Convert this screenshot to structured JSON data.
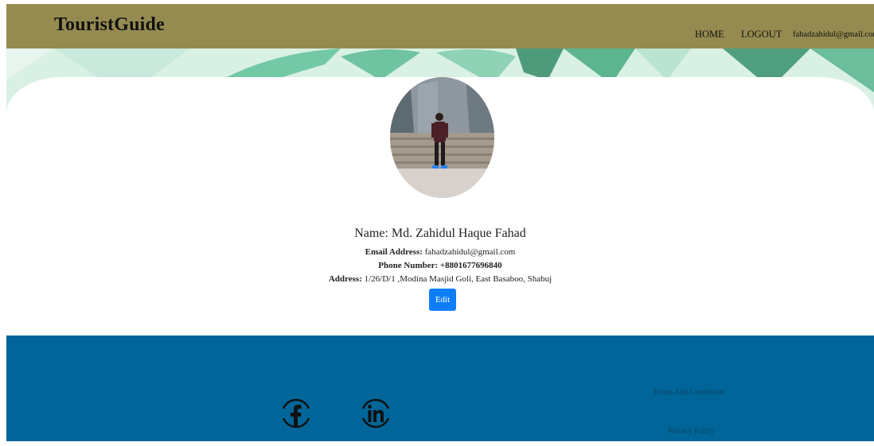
{
  "header": {
    "brand": "TouristGuide",
    "nav": {
      "home": "HOME",
      "logout": "LOGOUT",
      "user_email": "fahadzahidul@gmail.com"
    }
  },
  "profile": {
    "name_label": "Name:",
    "name": "Md. Zahidul Haque Fahad",
    "email_label": "Email Address:",
    "email": "fahadzahidul@gmail.com",
    "phone_label": "Phone Number:",
    "phone": "+8801677696840",
    "address_label": "Address:",
    "address": "1/26/D/1 ,Modina Masjid Goli, East Basaboo, Shabuj",
    "edit_label": "Edit"
  },
  "footer": {
    "social": [
      "facebook-icon",
      "linkedin-icon"
    ],
    "terms": "Terms And Conditions",
    "privacy": "Privacy Policy"
  },
  "colors": {
    "navbar": "#958b50",
    "banner": "#d8efe4",
    "footer": "#006598",
    "button": "#0d7ef8"
  }
}
